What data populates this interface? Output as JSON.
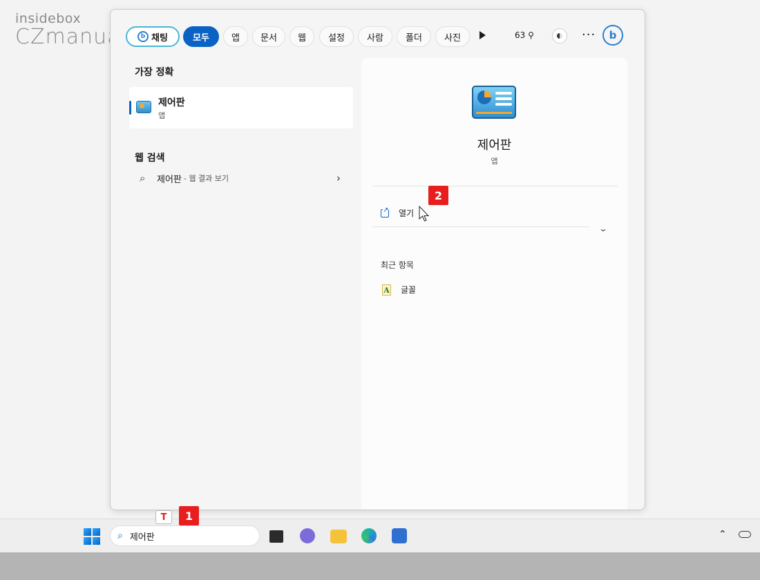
{
  "watermark": {
    "line1": "insidebox",
    "line2": "CZmanual"
  },
  "filters": {
    "chat_label": "채팅",
    "tabs": [
      {
        "label": "모두",
        "active": true
      },
      {
        "label": "앱"
      },
      {
        "label": "문서"
      },
      {
        "label": "웹"
      },
      {
        "label": "설정"
      },
      {
        "label": "사람"
      },
      {
        "label": "폴더"
      },
      {
        "label": "사진"
      }
    ],
    "score": "63 ⚲"
  },
  "left": {
    "best_match_title": "가장 정확",
    "best_match": {
      "name": "제어판",
      "type": "앱"
    },
    "web_title": "웹 검색",
    "web_result": {
      "query": "제어판",
      "hint": "- 웹 결과 보기"
    }
  },
  "right": {
    "name": "제어판",
    "type": "앱",
    "open_label": "열기",
    "recent_title": "최근 항목",
    "recent_items": [
      {
        "label": "글꼴"
      }
    ]
  },
  "badges": {
    "step1": "1",
    "step2": "2"
  },
  "ime": {
    "indicator": "T"
  },
  "taskbar": {
    "search_value": "제어판"
  },
  "colors": {
    "accent": "#0a63c4",
    "badge": "#e81d1d"
  }
}
